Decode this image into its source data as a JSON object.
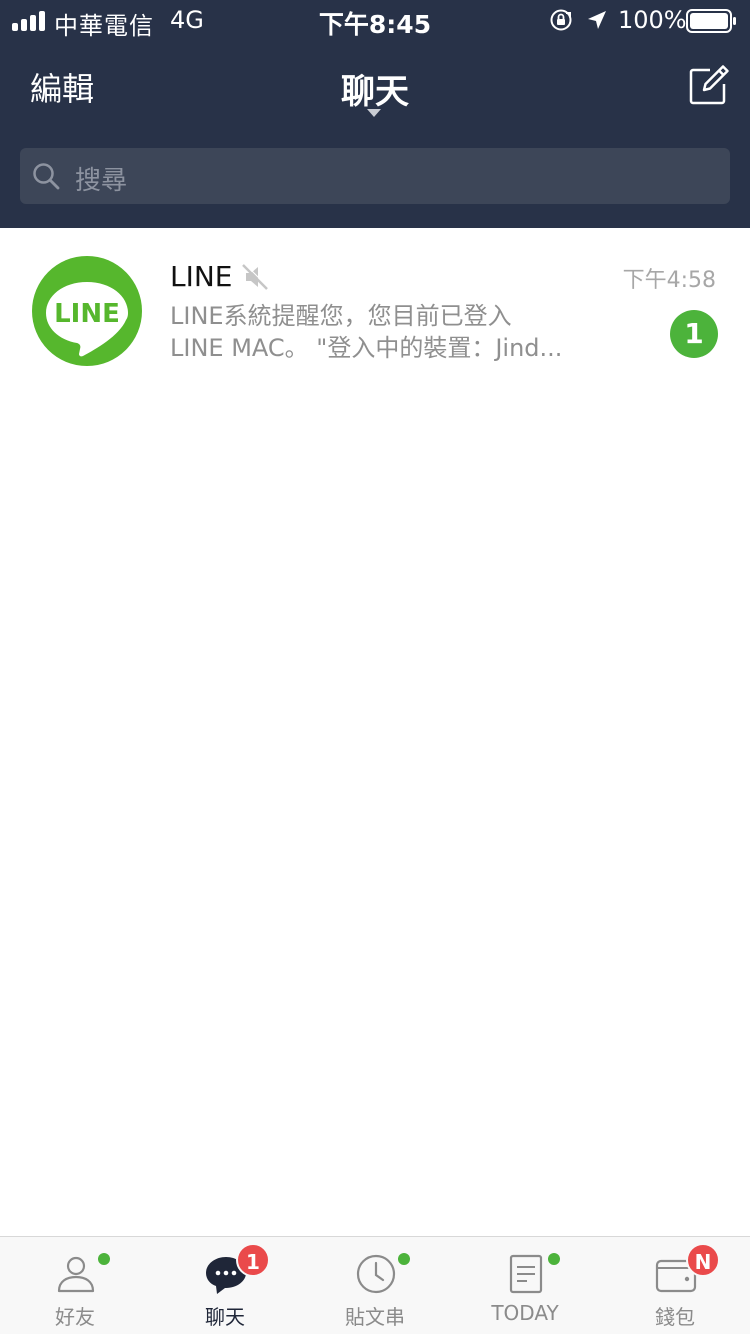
{
  "status_bar": {
    "carrier": "中華電信",
    "network": "4G",
    "time": "下午8:45",
    "battery_percent": "100%",
    "signal_bars": 4,
    "battery_level": 1.0,
    "icons": [
      "orientation-lock-icon",
      "location-arrow-icon",
      "battery-icon"
    ]
  },
  "nav": {
    "edit_label": "編輯",
    "title": "聊天",
    "compose_icon": "compose-icon"
  },
  "search": {
    "placeholder": "搜尋",
    "icon": "search-icon"
  },
  "chats": [
    {
      "name": "LINE",
      "muted": true,
      "time": "下午4:58",
      "preview_line1": "LINE系統提醒您，您目前已登入",
      "preview_line2": "LINE MAC。 \"登入中的裝置：Jind...",
      "unread": "1",
      "avatar_text": "LINE"
    }
  ],
  "tabs": [
    {
      "label": "好友",
      "icon": "friends-icon",
      "dot": true,
      "badge": ""
    },
    {
      "label": "聊天",
      "icon": "chat-bubble-icon",
      "dot": false,
      "badge": "1",
      "active": true
    },
    {
      "label": "貼文串",
      "icon": "clock-icon",
      "dot": true,
      "badge": ""
    },
    {
      "label": "TODAY",
      "icon": "document-icon",
      "dot": true,
      "badge": ""
    },
    {
      "label": "錢包",
      "icon": "wallet-icon",
      "dot": false,
      "badge": "N"
    }
  ],
  "colors": {
    "header_bg": "#283248",
    "search_bg": "#3d4658",
    "line_green": "#56b72d",
    "unread_green": "#4cb33b",
    "badge_red": "#ea4a4b"
  }
}
